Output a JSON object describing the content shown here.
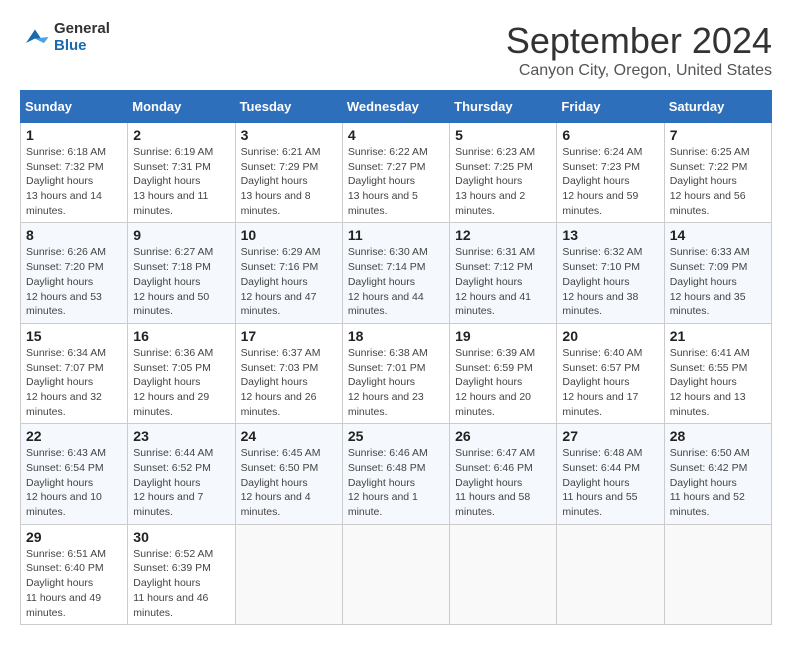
{
  "logo": {
    "general": "General",
    "blue": "Blue"
  },
  "header": {
    "month": "September 2024",
    "location": "Canyon City, Oregon, United States"
  },
  "weekdays": [
    "Sunday",
    "Monday",
    "Tuesday",
    "Wednesday",
    "Thursday",
    "Friday",
    "Saturday"
  ],
  "weeks": [
    [
      {
        "day": "1",
        "sunrise": "6:18 AM",
        "sunset": "7:32 PM",
        "daylight": "13 hours and 14 minutes."
      },
      {
        "day": "2",
        "sunrise": "6:19 AM",
        "sunset": "7:31 PM",
        "daylight": "13 hours and 11 minutes."
      },
      {
        "day": "3",
        "sunrise": "6:21 AM",
        "sunset": "7:29 PM",
        "daylight": "13 hours and 8 minutes."
      },
      {
        "day": "4",
        "sunrise": "6:22 AM",
        "sunset": "7:27 PM",
        "daylight": "13 hours and 5 minutes."
      },
      {
        "day": "5",
        "sunrise": "6:23 AM",
        "sunset": "7:25 PM",
        "daylight": "13 hours and 2 minutes."
      },
      {
        "day": "6",
        "sunrise": "6:24 AM",
        "sunset": "7:23 PM",
        "daylight": "12 hours and 59 minutes."
      },
      {
        "day": "7",
        "sunrise": "6:25 AM",
        "sunset": "7:22 PM",
        "daylight": "12 hours and 56 minutes."
      }
    ],
    [
      {
        "day": "8",
        "sunrise": "6:26 AM",
        "sunset": "7:20 PM",
        "daylight": "12 hours and 53 minutes."
      },
      {
        "day": "9",
        "sunrise": "6:27 AM",
        "sunset": "7:18 PM",
        "daylight": "12 hours and 50 minutes."
      },
      {
        "day": "10",
        "sunrise": "6:29 AM",
        "sunset": "7:16 PM",
        "daylight": "12 hours and 47 minutes."
      },
      {
        "day": "11",
        "sunrise": "6:30 AM",
        "sunset": "7:14 PM",
        "daylight": "12 hours and 44 minutes."
      },
      {
        "day": "12",
        "sunrise": "6:31 AM",
        "sunset": "7:12 PM",
        "daylight": "12 hours and 41 minutes."
      },
      {
        "day": "13",
        "sunrise": "6:32 AM",
        "sunset": "7:10 PM",
        "daylight": "12 hours and 38 minutes."
      },
      {
        "day": "14",
        "sunrise": "6:33 AM",
        "sunset": "7:09 PM",
        "daylight": "12 hours and 35 minutes."
      }
    ],
    [
      {
        "day": "15",
        "sunrise": "6:34 AM",
        "sunset": "7:07 PM",
        "daylight": "12 hours and 32 minutes."
      },
      {
        "day": "16",
        "sunrise": "6:36 AM",
        "sunset": "7:05 PM",
        "daylight": "12 hours and 29 minutes."
      },
      {
        "day": "17",
        "sunrise": "6:37 AM",
        "sunset": "7:03 PM",
        "daylight": "12 hours and 26 minutes."
      },
      {
        "day": "18",
        "sunrise": "6:38 AM",
        "sunset": "7:01 PM",
        "daylight": "12 hours and 23 minutes."
      },
      {
        "day": "19",
        "sunrise": "6:39 AM",
        "sunset": "6:59 PM",
        "daylight": "12 hours and 20 minutes."
      },
      {
        "day": "20",
        "sunrise": "6:40 AM",
        "sunset": "6:57 PM",
        "daylight": "12 hours and 17 minutes."
      },
      {
        "day": "21",
        "sunrise": "6:41 AM",
        "sunset": "6:55 PM",
        "daylight": "12 hours and 13 minutes."
      }
    ],
    [
      {
        "day": "22",
        "sunrise": "6:43 AM",
        "sunset": "6:54 PM",
        "daylight": "12 hours and 10 minutes."
      },
      {
        "day": "23",
        "sunrise": "6:44 AM",
        "sunset": "6:52 PM",
        "daylight": "12 hours and 7 minutes."
      },
      {
        "day": "24",
        "sunrise": "6:45 AM",
        "sunset": "6:50 PM",
        "daylight": "12 hours and 4 minutes."
      },
      {
        "day": "25",
        "sunrise": "6:46 AM",
        "sunset": "6:48 PM",
        "daylight": "12 hours and 1 minute."
      },
      {
        "day": "26",
        "sunrise": "6:47 AM",
        "sunset": "6:46 PM",
        "daylight": "11 hours and 58 minutes."
      },
      {
        "day": "27",
        "sunrise": "6:48 AM",
        "sunset": "6:44 PM",
        "daylight": "11 hours and 55 minutes."
      },
      {
        "day": "28",
        "sunrise": "6:50 AM",
        "sunset": "6:42 PM",
        "daylight": "11 hours and 52 minutes."
      }
    ],
    [
      {
        "day": "29",
        "sunrise": "6:51 AM",
        "sunset": "6:40 PM",
        "daylight": "11 hours and 49 minutes."
      },
      {
        "day": "30",
        "sunrise": "6:52 AM",
        "sunset": "6:39 PM",
        "daylight": "11 hours and 46 minutes."
      },
      null,
      null,
      null,
      null,
      null
    ]
  ]
}
